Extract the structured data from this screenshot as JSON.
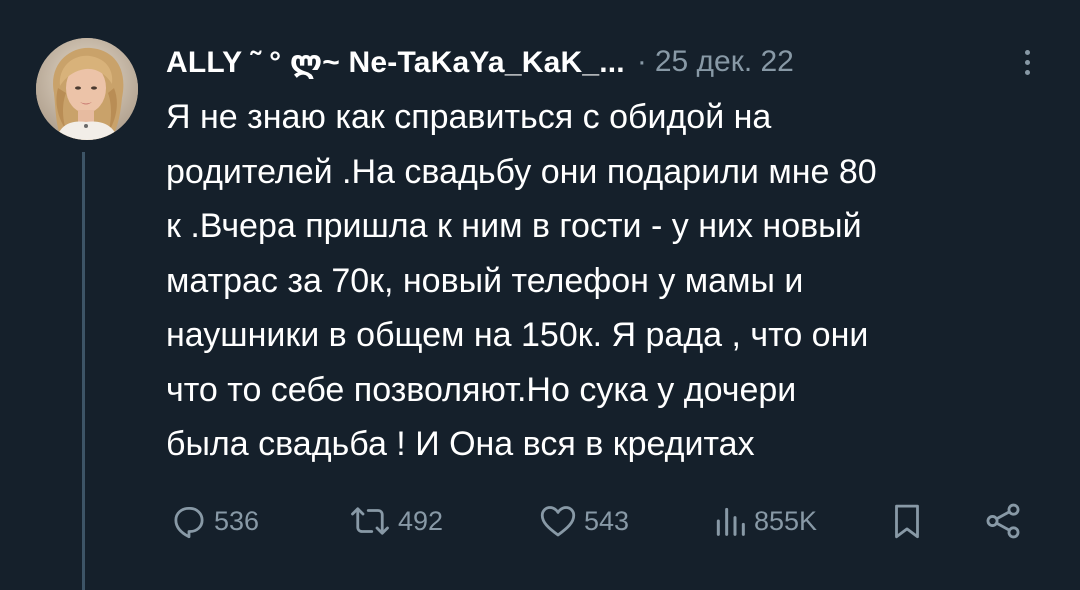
{
  "tweet": {
    "display_name": "ALLY ˜ ° ლ~ Ne-TaKaYa_KaK_...",
    "separator": "·",
    "date": "25 дек. 22",
    "text_lines": [
      "Я не знаю как справиться с обидой на",
      "родителей .На свадьбу они подарили мне 80",
      "к .Вчера пришла к ним в гости - у них новый",
      "матрас за 70к, новый телефон у мамы и",
      "наушники в общем на 150к. Я рада , что они",
      "что то себе позволяют.Но сука у дочери",
      "была свадьба ! И Она вся в кредитах"
    ],
    "actions": {
      "replies": "536",
      "retweets": "492",
      "likes": "543",
      "views": "855K"
    },
    "icons": {
      "reply": "reply-icon",
      "retweet": "retweet-icon",
      "like": "heart-icon",
      "views": "views-icon",
      "bookmark": "bookmark-icon",
      "share": "share-icon",
      "more": "more-icon"
    }
  },
  "colors": {
    "background": "#15202b",
    "text_primary": "#ffffff",
    "text_secondary": "#8899a6",
    "thread_line": "#3d5466"
  }
}
